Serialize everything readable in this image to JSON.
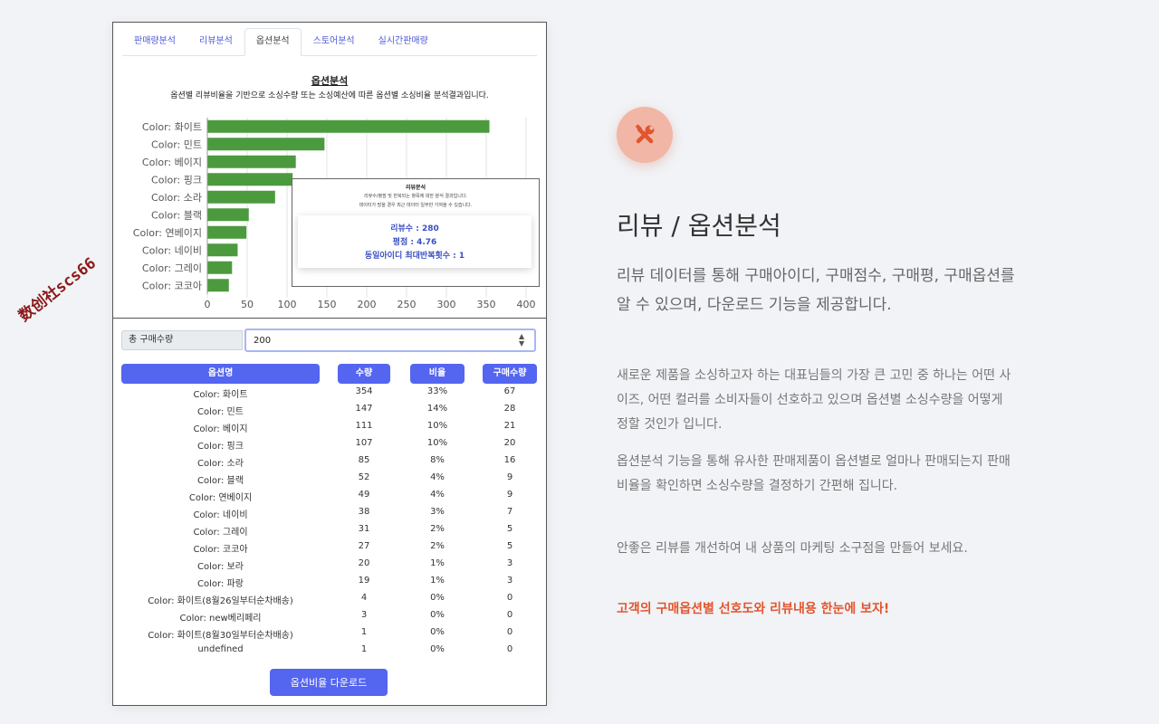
{
  "tabs": [
    "판매량분석",
    "리뷰분석",
    "옵션분석",
    "스토어분석",
    "실시간판매량"
  ],
  "active_tab": 2,
  "chart_title": "옵션분석",
  "chart_subtitle": "옵션별 리뷰비율을 기반으로 소싱수량 또는 소싱예산에 따른 옵션별 소싱비율 분석결과입니다.",
  "chart_data": {
    "type": "bar",
    "orientation": "horizontal",
    "categories": [
      "Color: 화이트",
      "Color: 민트",
      "Color: 베이지",
      "Color: 핑크",
      "Color: 소라",
      "Color: 블랙",
      "Color: 연베이지",
      "Color: 네이비",
      "Color: 그레이",
      "Color: 코코아"
    ],
    "values": [
      354,
      147,
      111,
      107,
      85,
      52,
      49,
      38,
      31,
      27
    ],
    "xlim": [
      0,
      400
    ],
    "ticks": [
      0,
      50,
      100,
      150,
      200,
      250,
      300,
      350,
      400
    ],
    "color": "#4c9a3e",
    "grid": true
  },
  "tooltip": {
    "title": "리뷰분석",
    "desc1": "리뷰수/평점 및 반복되는 항목에 대한 분석 결과입니다.",
    "desc2": "데이터가 많을 경우 최근 데이터 일부만 가져올 수 있습니다.",
    "review_count": "리뷰수 : 280",
    "rating": "평점 : 4.76",
    "max_repeat": "동일아이디 최대반복횟수 : 1"
  },
  "quantity": {
    "label": "총 구매수량",
    "value": "200"
  },
  "table": {
    "headers": [
      "옵션명",
      "수량",
      "비율",
      "구매수량"
    ],
    "rows": [
      [
        "Color: 화이트",
        "354",
        "33%",
        "67"
      ],
      [
        "Color: 민트",
        "147",
        "14%",
        "28"
      ],
      [
        "Color: 베이지",
        "111",
        "10%",
        "21"
      ],
      [
        "Color: 핑크",
        "107",
        "10%",
        "20"
      ],
      [
        "Color: 소라",
        "85",
        "8%",
        "16"
      ],
      [
        "Color: 블랙",
        "52",
        "4%",
        "9"
      ],
      [
        "Color: 연베이지",
        "49",
        "4%",
        "9"
      ],
      [
        "Color: 네이비",
        "38",
        "3%",
        "7"
      ],
      [
        "Color: 그레이",
        "31",
        "2%",
        "5"
      ],
      [
        "Color: 코코아",
        "27",
        "2%",
        "5"
      ],
      [
        "Color: 보라",
        "20",
        "1%",
        "3"
      ],
      [
        "Color: 파랑",
        "19",
        "1%",
        "3"
      ],
      [
        "Color: 화이트(8월26일부터순차배송)",
        "4",
        "0%",
        "0"
      ],
      [
        "Color: new베리페리",
        "3",
        "0%",
        "0"
      ],
      [
        "Color: 화이트(8월30일부터순차배송)",
        "1",
        "0%",
        "0"
      ],
      [
        "undefined",
        "1",
        "0%",
        "0"
      ]
    ]
  },
  "download_label": "옵션비율 다운로드",
  "watermark": "数创社scs66",
  "feature": {
    "icon": "tools-icon",
    "accent": "#e2552e",
    "title": "리뷰 / 옵션분석",
    "lead": "리뷰 데이터를 통해 구매아이디, 구매점수, 구매평, 구매옵션를 알 수 있으며, 다운로드 기능을 제공합니다.",
    "p1": "새로운 제품을 소싱하고자 하는 대표님들의 가장 큰 고민 중 하나는 어떤 사이즈, 어떤 컬러를 소비자들이 선호하고 있으며 옵션별 소싱수량을 어떻게 정할 것인가 입니다.",
    "p2": "옵션분석 기능을 통해 유사한 판매제품이 옵션별로 얼마나 판매되는지 판매비율을 확인하면 소싱수량을 결정하기 간편해 집니다.",
    "p3": "안좋은 리뷰를 개선하여 내 상품의 마케팅 소구점을 만들어 보세요.",
    "highlight": "고객의 구매옵션별 선호도와 리뷰내용 한눈에 보자!"
  }
}
